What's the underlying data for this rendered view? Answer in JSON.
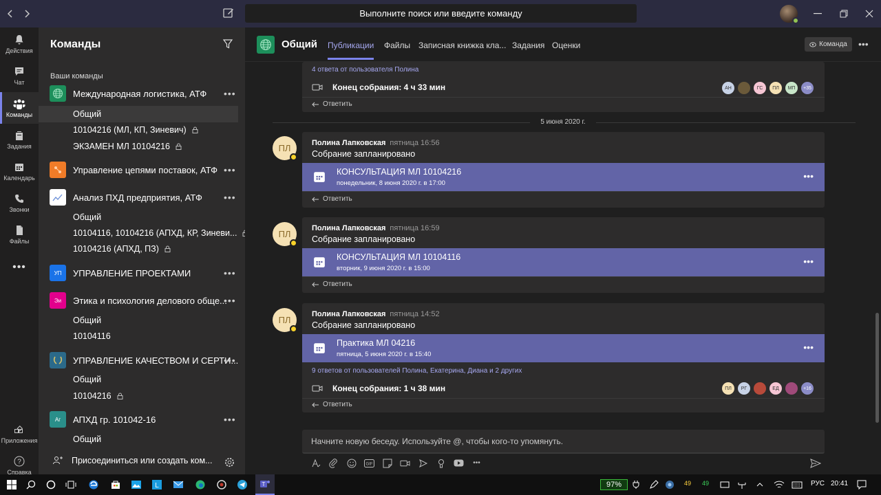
{
  "titlebar": {
    "search_placeholder": "Выполните поиск или введите команду"
  },
  "rail": [
    {
      "label": "Действия",
      "icon": "bell-icon"
    },
    {
      "label": "Чат",
      "icon": "chat-icon"
    },
    {
      "label": "Команды",
      "icon": "teams-icon",
      "active": true
    },
    {
      "label": "Задания",
      "icon": "assignments-icon"
    },
    {
      "label": "Календарь",
      "icon": "calendar-icon"
    },
    {
      "label": "Звонки",
      "icon": "phone-icon"
    },
    {
      "label": "Файлы",
      "icon": "files-icon"
    },
    {
      "label": "Приложения",
      "icon": "apps-icon"
    },
    {
      "label": "Справка",
      "icon": "help-icon"
    }
  ],
  "left": {
    "title": "Команды",
    "section_label": "Ваши команды",
    "teams": [
      {
        "name": "Международная логистика, АТФ",
        "logo_text": "",
        "color": "#1d8f5b",
        "channels": [
          {
            "name": "Общий",
            "selected": true
          },
          {
            "name": "10104216 (МЛ, КП, Зиневич)",
            "private": true
          },
          {
            "name": "ЭКЗАМЕН МЛ 10104216",
            "private": true
          }
        ]
      },
      {
        "name": "Управление цепями поставок, АТФ",
        "logo_text": "",
        "color": "#f07c28",
        "channels": []
      },
      {
        "name": "Анализ ПХД предприятия, АТФ",
        "logo_text": "",
        "color": "#ffffff",
        "channels": [
          {
            "name": "Общий"
          },
          {
            "name": "10104116, 10104216 (АПХД, КР, Зиневи...",
            "private": true
          },
          {
            "name": "10104216 (АПХД, ПЗ)",
            "private": true
          }
        ]
      },
      {
        "name": "УПРАВЛЕНИЕ ПРОЕКТАМИ",
        "logo_text": "УП",
        "color": "#1a73e8",
        "channels": []
      },
      {
        "name": "Этика и психология делового обще...",
        "logo_text": "Эи",
        "color": "#e3008c",
        "channels": [
          {
            "name": "Общий"
          },
          {
            "name": "10104116"
          }
        ]
      },
      {
        "name": "УПРАВЛЕНИЕ КАЧЕСТВОМ И СЕРТИ...",
        "logo_text": "",
        "color": "#2b6a8a",
        "channels": [
          {
            "name": "Общий"
          },
          {
            "name": "10104216",
            "private": true
          }
        ]
      },
      {
        "name": "АПХД гр. 101042-16",
        "logo_text": "Аг",
        "color": "#2a8f8a",
        "channels": [
          {
            "name": "Общий"
          }
        ]
      }
    ],
    "join_label": "Присоединиться или создать ком..."
  },
  "header": {
    "channel": "Общий",
    "tabs": [
      "Публикации",
      "Файлы",
      "Записная книжка кла...",
      "Задания",
      "Оценки"
    ],
    "team_button": "Команда"
  },
  "feed": {
    "top": {
      "replies": "4 ответа от пользователя Полина",
      "recording": "Конец собрания: 4 ч 33 мин",
      "participants": [
        {
          "initials": "АН",
          "color": "#c7d2e6"
        },
        {
          "initials": "",
          "color": "#6b5a3a"
        },
        {
          "initials": "ГС",
          "color": "#f6c6d4"
        },
        {
          "initials": "ПЛ",
          "color": "#f5e1b4"
        },
        {
          "initials": "МП",
          "color": "#c8e6c9"
        },
        {
          "initials": "+35",
          "color": "#8b8cc7"
        }
      ],
      "reply_label": "Ответить"
    },
    "date_separator": "5 июня 2020 г.",
    "posts": [
      {
        "author_initials": "ПЛ",
        "author": "Полина Лапковская",
        "time": "пятница 16:56",
        "text": "Собрание запланировано",
        "meeting_title": "КОНСУЛЬТАЦИЯ МЛ 10104216",
        "meeting_time": "понедельник, 8 июня 2020 г. в 17:00",
        "reply_label": "Ответить"
      },
      {
        "author_initials": "ПЛ",
        "author": "Полина Лапковская",
        "time": "пятница 16:59",
        "text": "Собрание запланировано",
        "meeting_title": "КОНСУЛЬТАЦИЯ МЛ 10104116",
        "meeting_time": "вторник, 9 июня 2020 г. в 15:00",
        "reply_label": "Ответить"
      },
      {
        "author_initials": "ПЛ",
        "author": "Полина Лапковская",
        "time": "пятница 14:52",
        "text": "Собрание запланировано",
        "meeting_title": "Практика МЛ 04216",
        "meeting_time": "пятница, 5 июня 2020 г. в 15:40",
        "replies": "9 ответов от пользователей Полина, Екатерина, Диана и 2 других",
        "recording": "Конец собрания: 1 ч 38 мин",
        "participants": [
          {
            "initials": "ПЛ",
            "color": "#f5e1b4"
          },
          {
            "initials": "РГ",
            "color": "#c7d2e6"
          },
          {
            "initials": "",
            "color": "#b84a3a"
          },
          {
            "initials": "ЕД",
            "color": "#f6c6d4"
          },
          {
            "initials": "",
            "color": "#a04a7a"
          },
          {
            "initials": "+16",
            "color": "#8b8cc7"
          }
        ],
        "reply_label": "Ответить"
      }
    ]
  },
  "compose": {
    "placeholder": "Начните новую беседу. Используйте @, чтобы кого-то упомянуть."
  },
  "taskbar": {
    "battery": "97%",
    "temp1": "49",
    "temp2": "49",
    "lang": "РУС",
    "clock": "20:41"
  }
}
